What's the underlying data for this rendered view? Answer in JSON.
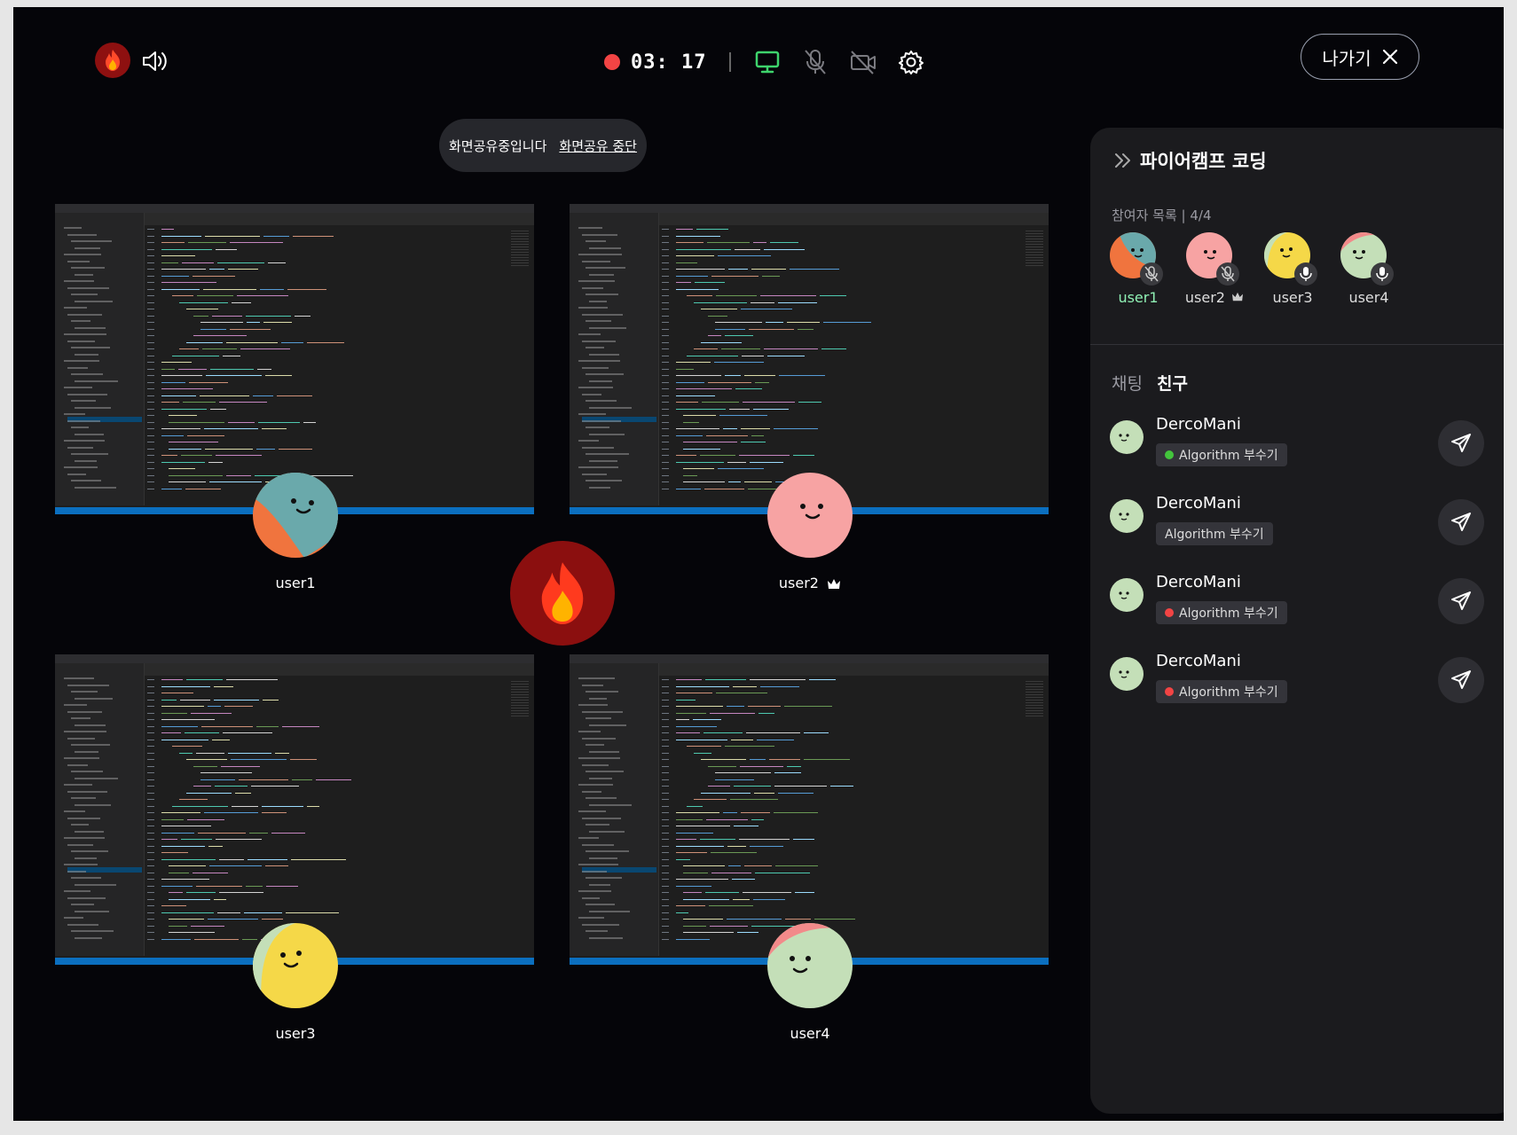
{
  "header": {
    "record_time": "03: 17",
    "exit_label": "나가기"
  },
  "share_banner": {
    "message": "화면공유중입니다",
    "stop_label": "화면공유 중단"
  },
  "tiles": [
    {
      "user": "user1",
      "crown": false
    },
    {
      "user": "user2",
      "crown": true
    },
    {
      "user": "user3",
      "crown": false
    },
    {
      "user": "user4",
      "crown": false
    }
  ],
  "panel": {
    "title": "파이어캠프 코딩",
    "participants_label": "참여자 목록 | 4/4",
    "participants": [
      {
        "name": "user1",
        "mic": "muted",
        "highlight": true
      },
      {
        "name": "user2",
        "mic": "muted",
        "crown": true
      },
      {
        "name": "user3",
        "mic": "on"
      },
      {
        "name": "user4",
        "mic": "on"
      }
    ],
    "tabs": [
      "채팅",
      "친구"
    ],
    "active_tab": "친구",
    "friends": [
      {
        "name": "DercoMani",
        "status": "Algorithm 부수기",
        "status_color": "#43c43c"
      },
      {
        "name": "DercoMani",
        "status": "Algorithm 부수기",
        "status_color": ""
      },
      {
        "name": "DercoMani",
        "status": "Algorithm 부수기",
        "status_color": "#f24444"
      },
      {
        "name": "DercoMani",
        "status": "Algorithm 부수기",
        "status_color": "#f24444"
      }
    ]
  },
  "colors": {
    "background": "#050509",
    "panel": "#1b1b1e",
    "record_dot": "#f24444",
    "screen_share_icon": "#3ed46c",
    "highlight_user": "#8ff0b4",
    "fire_circle": "#8b0f0f"
  },
  "icons": {
    "logo": "fire-icon",
    "speaker": "speaker-icon",
    "screen_share": "monitor-icon",
    "mic": "mic-off-icon",
    "camera": "camera-off-icon",
    "settings": "gear-icon",
    "exit": "close-icon",
    "send": "send-icon",
    "crown": "crown-icon",
    "collapse": "chevron-double-right-icon"
  }
}
